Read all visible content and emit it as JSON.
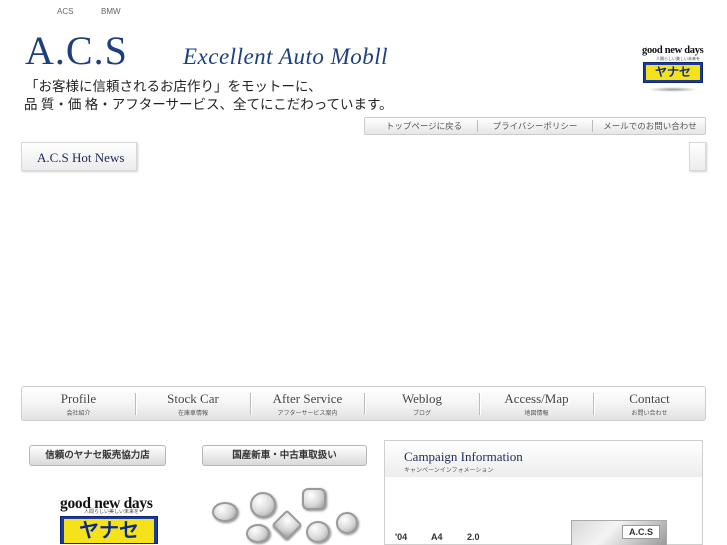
{
  "top_links": [
    "ACS",
    "BMW"
  ],
  "logo": {
    "main": "A.C.S",
    "sub": "Excellent Auto Mobll"
  },
  "tagline": [
    "「お客様に信頼されるお店作り」をモットーに、",
    "品 質・価 格・アフターサービス、全てにこだわっています。"
  ],
  "yanase": {
    "brand": "good new days",
    "tagline": "人間らしい美しい未来を",
    "name": "ヤナセ"
  },
  "subnav": [
    "トップページに戻る",
    "プライバシーポリシー",
    "メールでのお問い合わせ"
  ],
  "news": {
    "title": "A.C.S Hot News"
  },
  "mainnav": [
    {
      "en": "Profile",
      "jp": "会社紹介"
    },
    {
      "en": "Stock Car",
      "jp": "在庫車情報"
    },
    {
      "en": "After Service",
      "jp": "アフターサービス案内"
    },
    {
      "en": "Weblog",
      "jp": "ブログ"
    },
    {
      "en": "Access/Map",
      "jp": "地図情報"
    },
    {
      "en": "Contact",
      "jp": "お問い合わせ"
    }
  ],
  "buttons": {
    "yanase_dealer": "信頼のヤナセ販売協力店",
    "new_used": "国産新車・中古車取扱い"
  },
  "campaign": {
    "title": "Campaign Information",
    "subtitle": "キャンペーンインフォメーション",
    "row": [
      "'04",
      "A4",
      "2.0"
    ],
    "photo_sign": "A.C.S"
  }
}
